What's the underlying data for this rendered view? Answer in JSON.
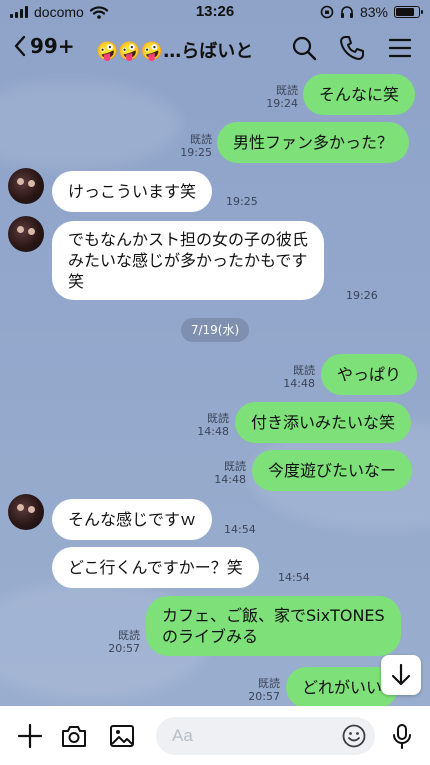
{
  "status_bar": {
    "carrier": "docomo",
    "time": "13:26",
    "battery": "83%",
    "battery_level": 0.83
  },
  "header": {
    "back_count": "99+",
    "title": "🤪🤪🤪…らばいと"
  },
  "date_separator": "7/19(水)",
  "messages": [
    {
      "side": "out",
      "text": "そんなに笑",
      "read": "既読",
      "time": "19:24"
    },
    {
      "side": "out",
      "text": "男性ファン多かった？",
      "read": "既読",
      "time": "19:25"
    },
    {
      "side": "in",
      "text": "けっこういます笑",
      "time": "19:25"
    },
    {
      "side": "in",
      "lines": [
        "でもなんかスト担の女の子の彼氏",
        "みたいな感じが多かったかもです",
        "笑"
      ],
      "time": "19:26"
    },
    {
      "side": "out",
      "text": "やっぱり",
      "read": "既読",
      "time": "14:48"
    },
    {
      "side": "out",
      "text": "付き添いみたいな笑",
      "read": "既読",
      "time": "14:48"
    },
    {
      "side": "out",
      "text": "今度遊びたいなー",
      "read": "既読",
      "time": "14:48"
    },
    {
      "side": "in",
      "text": "そんな感じですｗ",
      "time": "14:54"
    },
    {
      "side": "in",
      "text": "どこ行くんですかー？笑",
      "time": "14:54"
    },
    {
      "side": "out",
      "lines": [
        "カフェ、ご飯、家でSixTONES",
        "のライブみる"
      ],
      "read": "既読",
      "time": "20:57"
    },
    {
      "side": "out",
      "text": "どれがいい",
      "read": "既読",
      "time": "20:57"
    }
  ],
  "composer": {
    "placeholder": "Aa"
  },
  "icons": {
    "back": "chevron-left-icon",
    "search": "search-icon",
    "call": "phone-icon",
    "menu": "menu-icon",
    "add": "plus-icon",
    "camera": "camera-icon",
    "image": "image-icon",
    "emoji": "emoji-icon",
    "mic": "mic-icon",
    "scroll_down": "arrow-down-icon"
  },
  "colors": {
    "outgoing_bubble": "#7ee078",
    "incoming_bubble": "#ffffff",
    "chat_background": "#8fa3c9"
  }
}
